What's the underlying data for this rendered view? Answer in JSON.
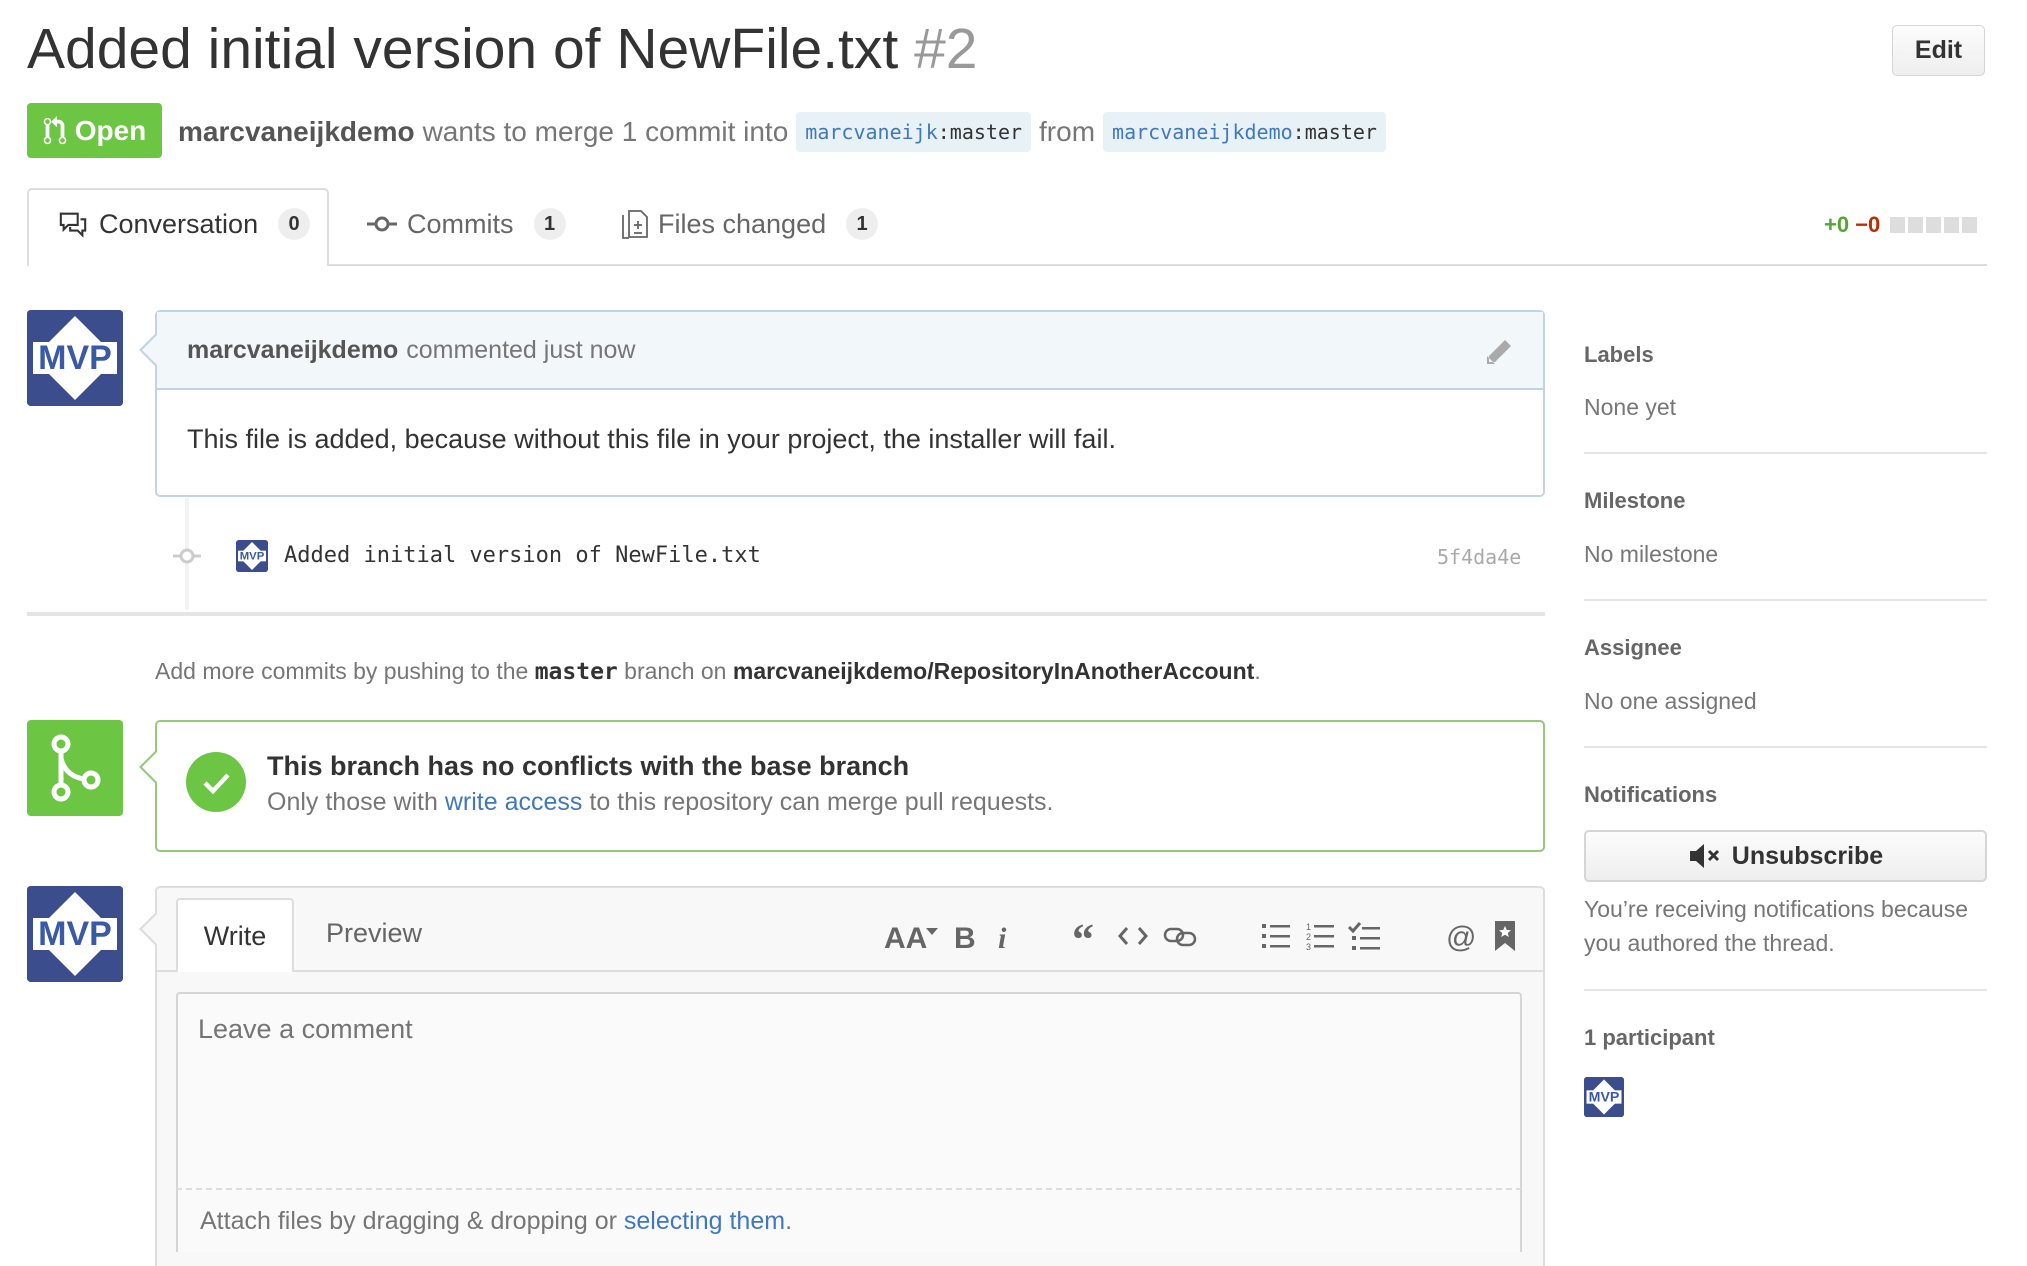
{
  "header": {
    "title": "Added initial version of NewFile.txt",
    "number": "#2",
    "edit_label": "Edit",
    "state_label": "Open",
    "author": "marcvaneijkdemo",
    "merge_text": "wants to merge 1 commit into",
    "base_user": "marcvaneijk",
    "base_branch": ":master",
    "from_text": "from",
    "head_user": "marcvaneijkdemo",
    "head_branch": ":master"
  },
  "tabs": [
    {
      "label": "Conversation",
      "count": "0",
      "icon": "comment-discussion-icon"
    },
    {
      "label": "Commits",
      "count": "1",
      "icon": "git-commit-icon"
    },
    {
      "label": "Files changed",
      "count": "1",
      "icon": "diff-icon"
    }
  ],
  "diffstat": {
    "additions": "+0",
    "deletions": "−0"
  },
  "comment": {
    "author": "marcvaneijkdemo",
    "action": "commented just now",
    "body": "This file is added, because without this file in your project, the installer will fail.",
    "avatar_text": "MVP"
  },
  "commit": {
    "message": "Added initial version of NewFile.txt",
    "sha": "5f4da4e"
  },
  "push_hint": {
    "prefix": "Add more commits by pushing to the",
    "branch": "master",
    "middle": "branch on",
    "repo": "marcvaneijkdemo/RepositoryInAnotherAccount",
    "suffix": "."
  },
  "merge": {
    "title": "This branch has no conflicts with the base branch",
    "sub_prefix": "Only those with",
    "sub_link": "write access",
    "sub_suffix": "to this repository can merge pull requests."
  },
  "new_comment": {
    "write_tab": "Write",
    "preview_tab": "Preview",
    "placeholder": "Leave a comment",
    "attach_prefix": "Attach files by dragging & dropping or",
    "attach_link": "selecting them",
    "attach_suffix": "."
  },
  "sidebar": {
    "labels_heading": "Labels",
    "labels_value": "None yet",
    "milestone_heading": "Milestone",
    "milestone_value": "No milestone",
    "assignee_heading": "Assignee",
    "assignee_value": "No one assigned",
    "notifications_heading": "Notifications",
    "unsubscribe_label": "Unsubscribe",
    "notifications_text": "You’re receiving notifications because you authored the thread.",
    "participants_heading": "1 participant"
  },
  "colors": {
    "open_green": "#6cc644",
    "link_blue": "#4078c0",
    "comment_border": "#c0d3eb"
  }
}
